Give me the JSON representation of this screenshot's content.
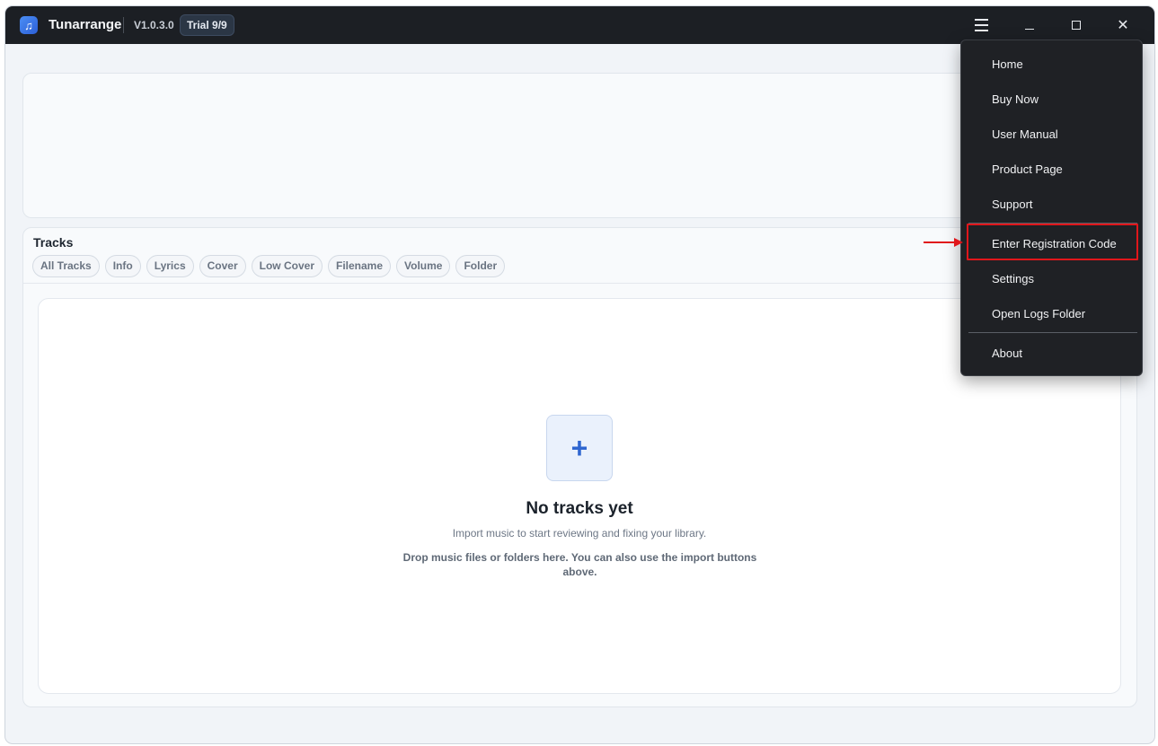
{
  "titlebar": {
    "app_name": "Tunarrange",
    "version": "V1.0.3.0",
    "trial_badge": "Trial 9/9",
    "close_glyph": "✕"
  },
  "tracks": {
    "title": "Tracks",
    "filters": [
      "All Tracks",
      "Info",
      "Lyrics",
      "Cover",
      "Low Cover",
      "Filename",
      "Volume",
      "Folder"
    ]
  },
  "empty_state": {
    "plus_glyph": "+",
    "title": "No tracks yet",
    "subtitle": "Import music to start reviewing and fixing your library.",
    "hint": "Drop music files or folders here. You can also use the import buttons above."
  },
  "menu": {
    "items": [
      "Home",
      "Buy Now",
      "User Manual",
      "Product Page",
      "Support",
      "Enter Registration Code",
      "Settings",
      "Open Logs Folder",
      "About"
    ],
    "highlighted": "Enter Registration Code"
  },
  "colors": {
    "titlebar_bg": "#1c1f24",
    "menu_bg": "#1f2125",
    "highlight": "#e0161b",
    "accent": "#2f66d0"
  }
}
